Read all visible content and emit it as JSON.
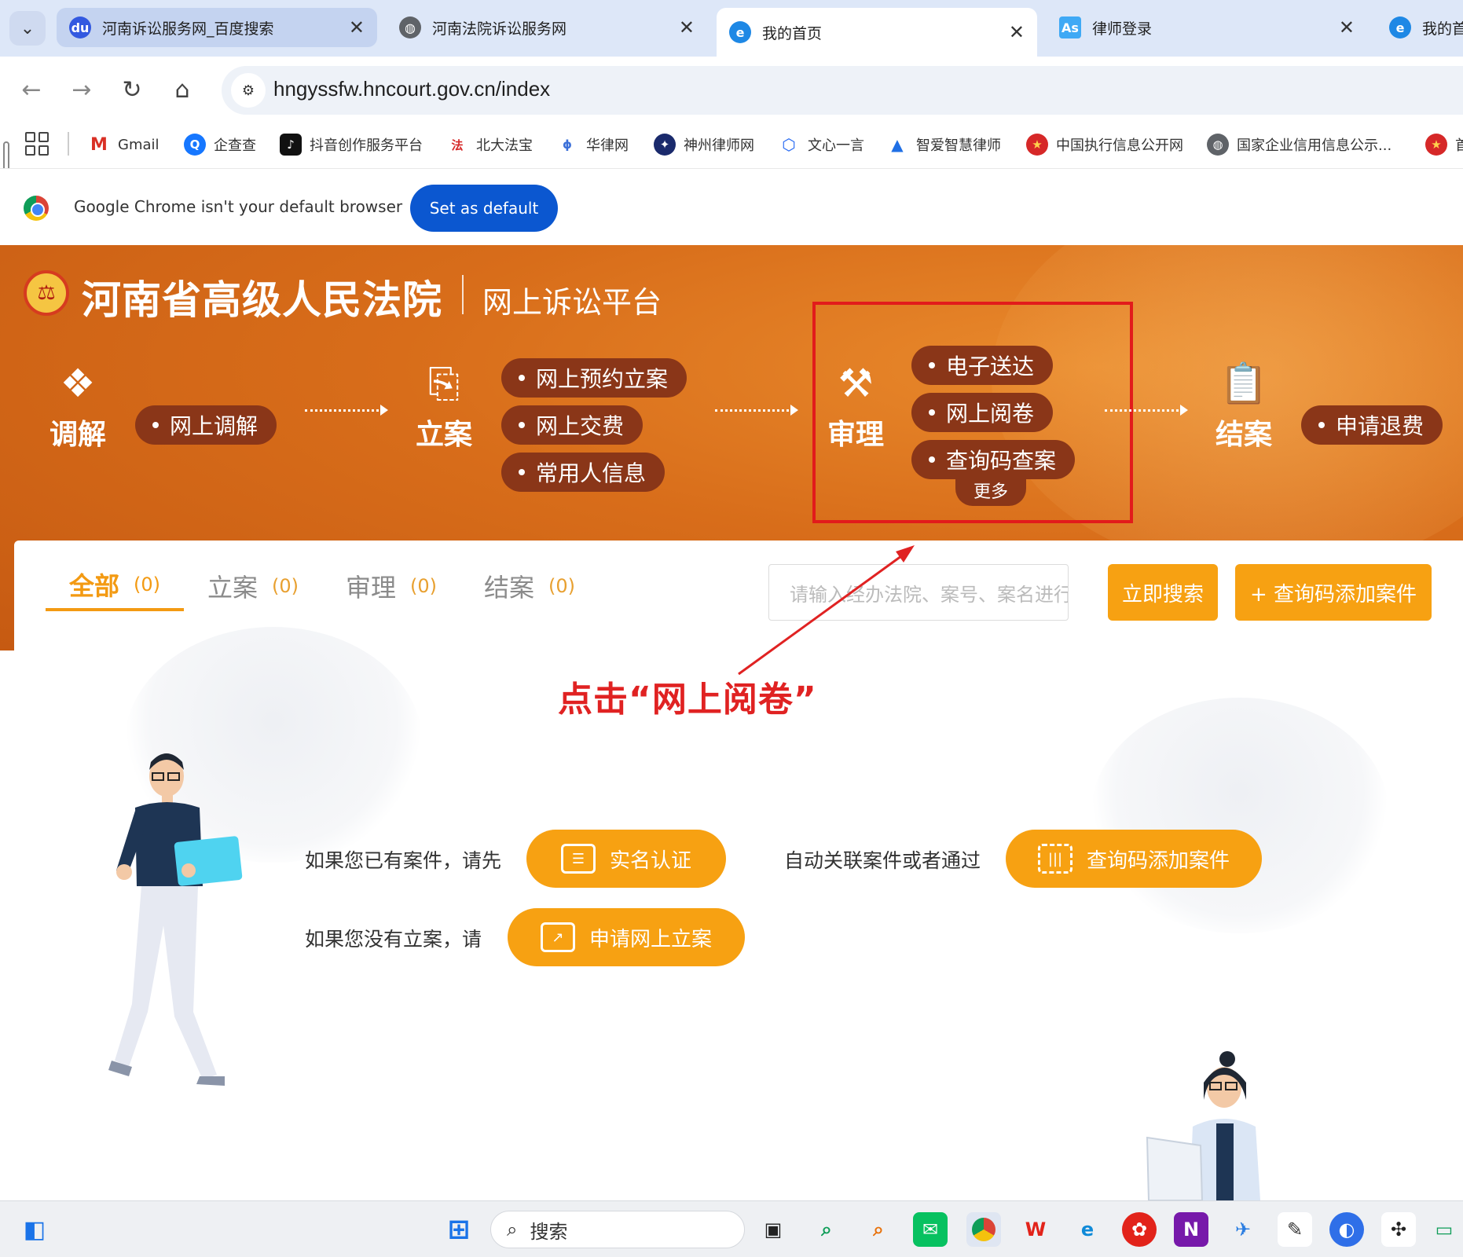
{
  "browser": {
    "tabs": [
      {
        "title": "河南诉讼服务网_百度搜索",
        "icon": "baidu-icon",
        "state": "hover"
      },
      {
        "title": "河南法院诉讼服务网",
        "icon": "globe-icon",
        "state": "normal"
      },
      {
        "title": "我的首页",
        "icon": "ie-icon",
        "state": "active"
      },
      {
        "title": "律师登录",
        "icon": "as-icon",
        "state": "normal"
      },
      {
        "title": "我的首"
      }
    ],
    "url": "hngyssfw.hncourt.gov.cn/index",
    "bookmarks": [
      {
        "label": "Gmail",
        "icon": "gmail-icon"
      },
      {
        "label": "企查查",
        "icon": "qcc-icon"
      },
      {
        "label": "抖音创作服务平台",
        "icon": "douyin-icon"
      },
      {
        "label": "北大法宝",
        "icon": "pkulaw-icon"
      },
      {
        "label": "华律网",
        "icon": "66law-icon"
      },
      {
        "label": "神州律师网",
        "icon": "shenzhou-icon"
      },
      {
        "label": "文心一言",
        "icon": "wenxin-icon"
      },
      {
        "label": "智爱智慧律师",
        "icon": "zhiai-icon"
      },
      {
        "label": "中国执行信息公开网",
        "icon": "zxgk-icon"
      },
      {
        "label": "国家企业信用信息公示...",
        "icon": "globe-icon"
      },
      {
        "label": "首",
        "icon": "emblem-icon"
      }
    ],
    "infobar": {
      "message": "Google Chrome isn't your default browser",
      "button": "Set as default"
    }
  },
  "banner": {
    "court_name": "河南省高级人民法院",
    "platform_name": "网上诉讼平台",
    "stages": [
      {
        "label": "调解",
        "items": [
          "网上调解"
        ]
      },
      {
        "label": "立案",
        "items": [
          "网上预约立案",
          "网上交费",
          "常用人信息"
        ]
      },
      {
        "label": "审理",
        "items": [
          "电子送达",
          "网上阅卷",
          "查询码查案"
        ],
        "more": "更多"
      },
      {
        "label": "结案",
        "items": [
          "申请退费"
        ]
      }
    ]
  },
  "main": {
    "tabs": [
      {
        "label": "全部",
        "count": "(0)",
        "active": true
      },
      {
        "label": "立案",
        "count": "(0)"
      },
      {
        "label": "审理",
        "count": "(0)"
      },
      {
        "label": "结案",
        "count": "(0)"
      }
    ],
    "search_placeholder": "请输入经办法院、案号、案名进行",
    "search_button": "立即搜索",
    "add_case_button": "+ 查询码添加案件",
    "annotation": "点击“网上阅卷”",
    "guide": {
      "line1_prefix": "如果您已有案件，请先",
      "realname_button": "实名认证",
      "line1_middle": "自动关联案件或者通过",
      "querycode_button": "查询码添加案件",
      "line2_prefix": "如果您没有立案，请",
      "apply_button": "申请网上立案"
    }
  },
  "taskbar": {
    "search_label": "搜索"
  },
  "colors": {
    "accent_orange": "#f7a112",
    "banner_orange": "#d86d1a",
    "pill_brown": "#8a3618",
    "annotation_red": "#e02222",
    "chrome_blue": "#0b57d0"
  }
}
